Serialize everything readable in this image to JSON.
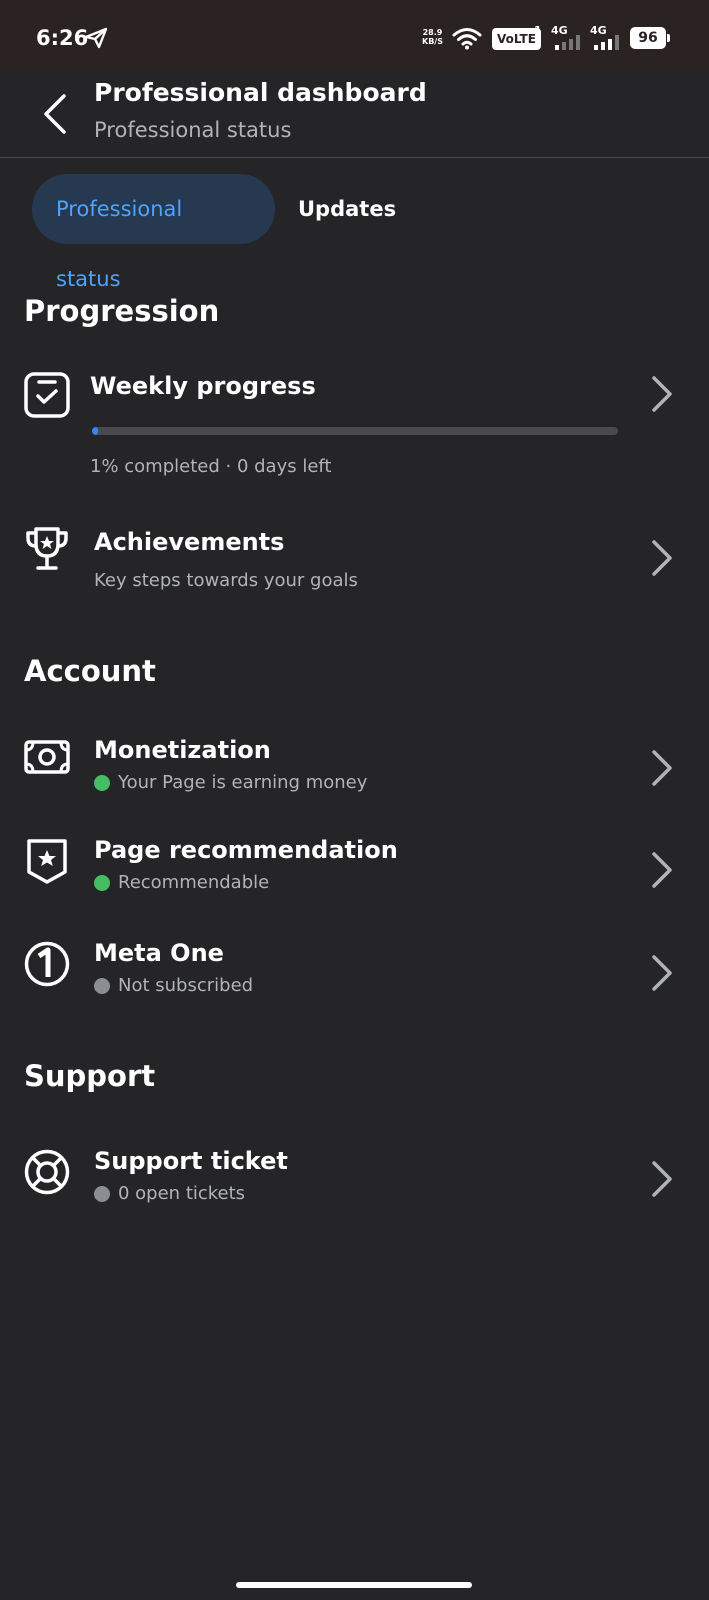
{
  "status_bar": {
    "time": "6:26",
    "net_speed_value": "28.9",
    "net_speed_unit": "KB/S",
    "volte": "VoLTE",
    "sim1_indicator": "1",
    "network1": "4G",
    "network2": "4G",
    "battery": "96",
    "icons": [
      "send-icon",
      "wifi-icon",
      "signal-icon",
      "battery-icon"
    ]
  },
  "header": {
    "title": "Professional dashboard",
    "subtitle": "Professional status",
    "back_icon": "chevron-left-icon"
  },
  "tabs": [
    {
      "label": "Professional status",
      "active": true
    },
    {
      "label": "Updates",
      "active": false
    }
  ],
  "progression": {
    "title": "Progression",
    "weekly": {
      "title": "Weekly progress",
      "progress_fraction": 0.01,
      "completed_text": "1% completed · 0 days left",
      "icon": "checklist-icon"
    },
    "achievements": {
      "title": "Achievements",
      "subtitle": "Key steps towards your goals",
      "icon": "trophy-icon"
    }
  },
  "account": {
    "title": "Account",
    "items": [
      {
        "title": "Monetization",
        "subtitle": "Your Page is earning money",
        "status_color": "#45bd62",
        "icon": "money-icon"
      },
      {
        "title": "Page recommendation",
        "subtitle": "Recommendable",
        "status_color": "#45bd62",
        "icon": "shield-star-icon"
      },
      {
        "title": "Meta One",
        "subtitle": "Not subscribed",
        "status_color": "#8a8d91",
        "icon": "meta-one-icon"
      }
    ]
  },
  "support": {
    "title": "Support",
    "items": [
      {
        "title": "Support ticket",
        "subtitle": "0 open tickets",
        "status_color": "#8a8d91",
        "icon": "lifebuoy-icon"
      }
    ]
  },
  "colors": {
    "background": "#252528",
    "status_bar": "#2b2222",
    "accent": "#2d88ff",
    "tab_active_bg": "#263951",
    "tab_active_text": "#4da3ff",
    "secondary_text": "#b0b3b8"
  }
}
